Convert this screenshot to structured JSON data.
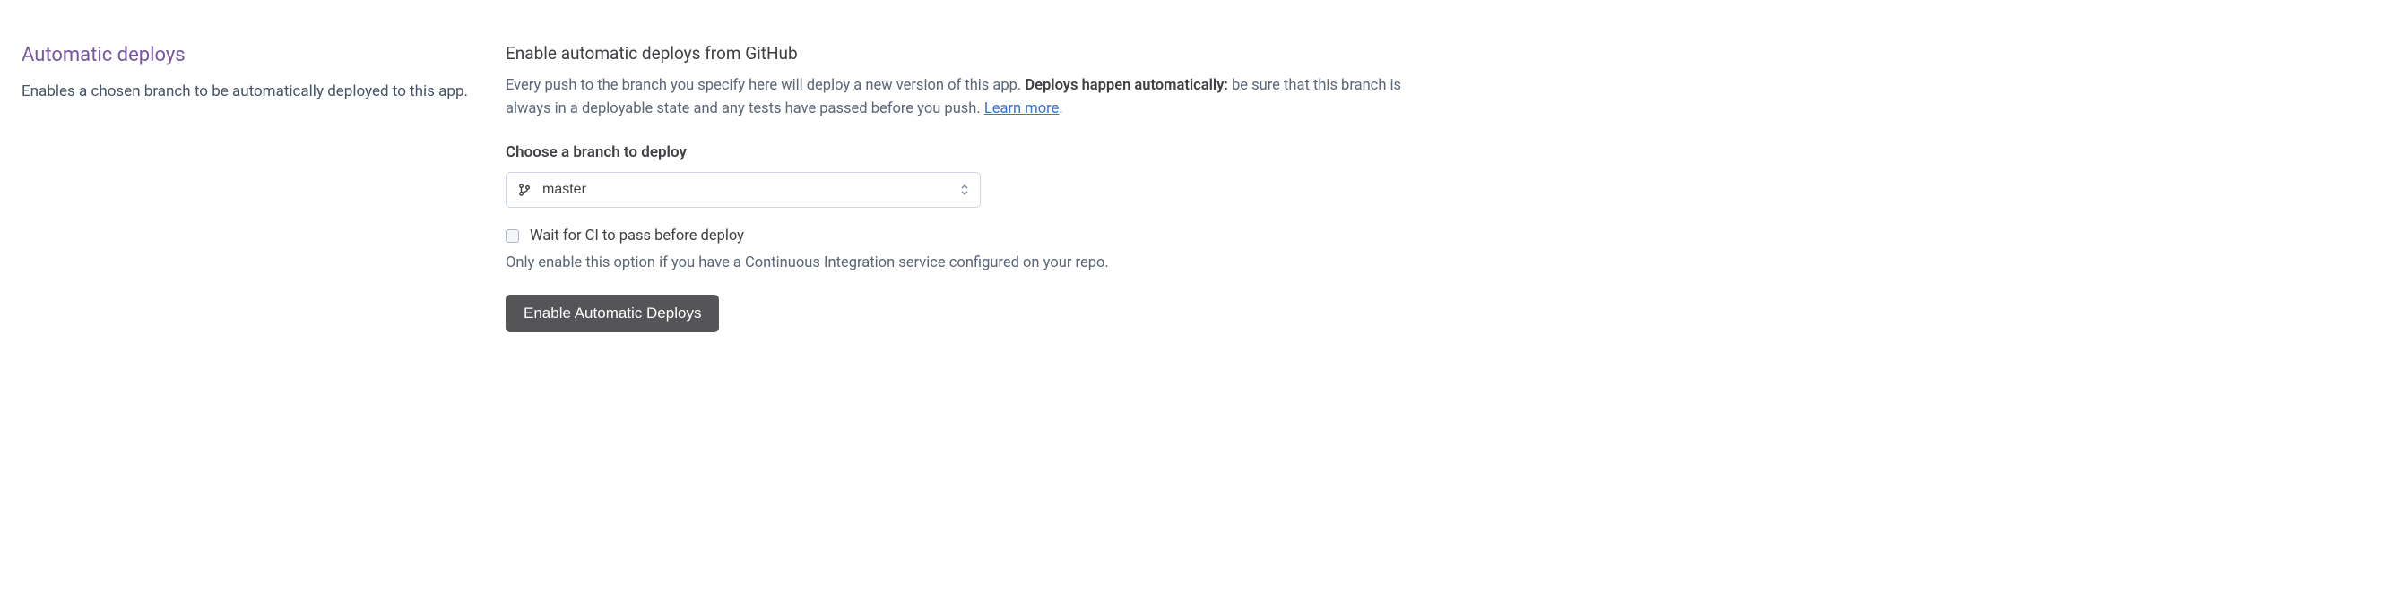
{
  "sidebar": {
    "title": "Automatic deploys",
    "description": "Enables a chosen branch to be automatically deployed to this app."
  },
  "main": {
    "heading": "Enable automatic deploys from GitHub",
    "paragraph_part1": "Every push to the branch you specify here will deploy a new version of this app. ",
    "paragraph_strong": "Deploys happen automatically:",
    "paragraph_part2": " be sure that this branch is always in a deployable state and any tests have passed before you push. ",
    "learn_more": "Learn more",
    "period": ".",
    "branch_label": "Choose a branch to deploy",
    "branch_value": "master",
    "ci_checkbox_label": "Wait for CI to pass before deploy",
    "ci_hint": "Only enable this option if you have a Continuous Integration service configured on your repo.",
    "enable_button": "Enable Automatic Deploys"
  }
}
